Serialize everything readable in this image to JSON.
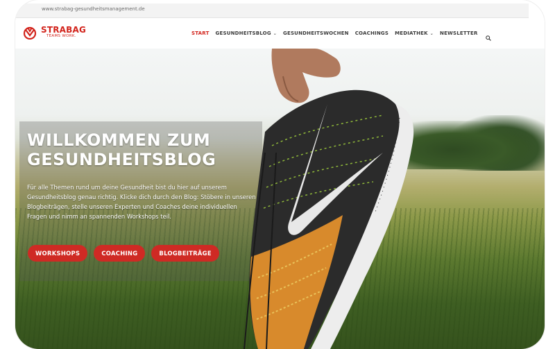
{
  "browser": {
    "url": "www.strabag-gesundheitsmanagement.de"
  },
  "brand": {
    "name": "STRABAG",
    "tagline": "TEAMS WORK.",
    "accent": "#d2231b"
  },
  "nav": {
    "items": [
      {
        "label": "START",
        "active": true,
        "dropdown": false
      },
      {
        "label": "GESUNDHEITSBLOG",
        "active": false,
        "dropdown": true
      },
      {
        "label": "GESUNDHEITSWOCHEN",
        "active": false,
        "dropdown": false
      },
      {
        "label": "COACHINGS",
        "active": false,
        "dropdown": false
      },
      {
        "label": "MEDIATHEK",
        "active": false,
        "dropdown": true
      },
      {
        "label": "NEWSLETTER",
        "active": false,
        "dropdown": false
      }
    ],
    "search_icon": "search-icon"
  },
  "hero": {
    "title_line1": "WILLKOMMEN ZUM",
    "title_line2": "GESUNDHEITSBLOG",
    "text": "Für alle Themen rund um deine Gesundheit bist du hier auf unserem Gesundheitsblog genau richtig. Klicke dich durch den Blog: Stöbere in unseren Blogbeiträgen, stelle unseren Experten und Coaches deine individuellen Fragen und nimm an spannenden Workshops teil.",
    "buttons": [
      "WORKSHOPS",
      "COACHING",
      "BLOGBEITRÄGE"
    ],
    "button_color": "#cf2a24"
  }
}
